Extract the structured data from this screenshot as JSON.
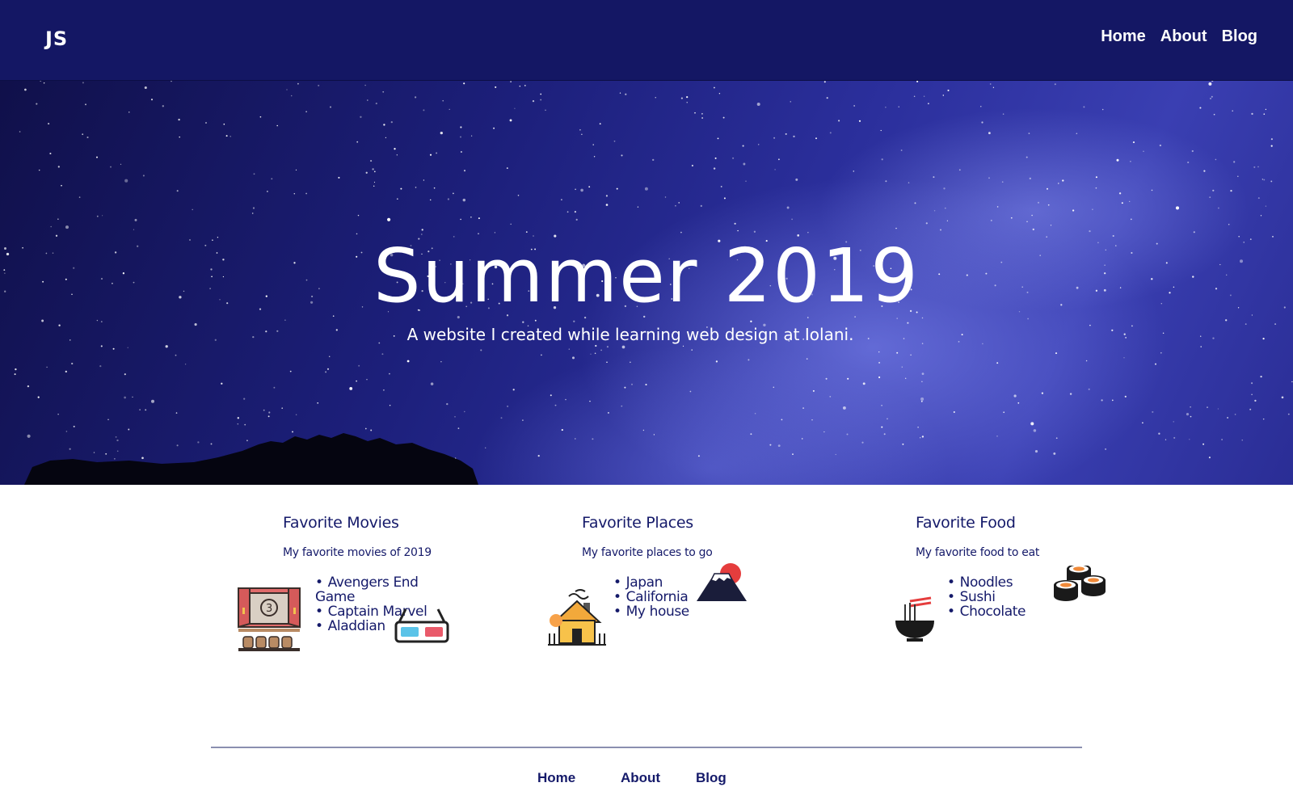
{
  "header": {
    "logo": "JS",
    "nav": [
      "Home",
      "About",
      "Blog"
    ]
  },
  "hero": {
    "title": "Summer 2019",
    "subtitle": "A website I created while learning web design at Iolani."
  },
  "sections": [
    {
      "title": "Favorite Movies",
      "description": "My favorite movies of 2019",
      "items": [
        "Avengers End Game",
        "Captain Marvel",
        "Aladdian"
      ],
      "icons": [
        "movie-theater-icon",
        "3d-glasses-icon"
      ]
    },
    {
      "title": "Favorite Places",
      "description": "My favorite places to go",
      "items": [
        "Japan",
        "California",
        "My house"
      ],
      "icons": [
        "house-icon",
        "mount-fuji-icon"
      ]
    },
    {
      "title": "Favorite Food",
      "description": "My favorite food to eat",
      "items": [
        "Noodles",
        "Sushi",
        "Chocolate"
      ],
      "icons": [
        "noodle-bowl-icon",
        "sushi-icon"
      ]
    }
  ],
  "footer": {
    "nav": [
      "Home",
      "About",
      "Blog"
    ]
  },
  "colors": {
    "header_bg": "#141764",
    "text_primary": "#151a6a",
    "divider": "#8a8fb0"
  }
}
